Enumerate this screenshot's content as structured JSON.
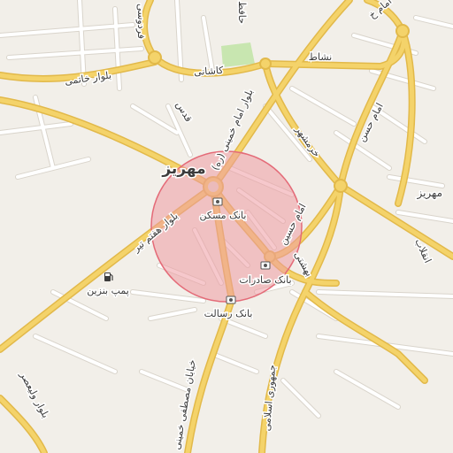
{
  "map": {
    "colors": {
      "land": "#f2efe9",
      "block": "#ffffff",
      "park": "#c8e6b0",
      "major_road": "#f4d36a",
      "major_road_casing": "#e2b94a",
      "minor_road": "#ffffff",
      "minor_road_casing": "#d9d4cb",
      "circle_fill": "#ef9aa2",
      "circle_stroke": "#e46b78",
      "label": "#3c3c3c",
      "label_halo": "#ffffff"
    },
    "highlight_circle": {
      "shape": "circle",
      "style": "translucent red radius overlay"
    },
    "labels": [
      {
        "name": "city-label",
        "text": "مهریز"
      },
      {
        "name": "town-label-east",
        "text": "مهریز"
      },
      {
        "name": "street-label-khatami",
        "text": "بلوار خاتمی"
      },
      {
        "name": "street-label-kashani",
        "text": "کاشانی"
      },
      {
        "name": "street-label-nashat",
        "text": "نشاط"
      },
      {
        "name": "street-label-imam-khomeini",
        "text": "بلوار امام خمینی (ره)"
      },
      {
        "name": "street-label-qods",
        "text": "قدس"
      },
      {
        "name": "street-label-khorramshahr",
        "text": "خرمشهر"
      },
      {
        "name": "street-label-imam-hasan",
        "text": "امام حسن"
      },
      {
        "name": "street-label-imam-hossein",
        "text": "امام حسین"
      },
      {
        "name": "street-label-imam-top",
        "text": "امام خ"
      },
      {
        "name": "street-label-beheshti",
        "text": "بهشتی"
      },
      {
        "name": "street-label-enghelab",
        "text": "انقلاب"
      },
      {
        "name": "street-label-haftom-tir",
        "text": "بلوار هفتم تیر"
      },
      {
        "name": "street-label-valiasr",
        "text": "بلوار ولیعصر"
      },
      {
        "name": "street-label-mostafa-khomeini",
        "text": "خیابان مصطفی خمینی"
      },
      {
        "name": "street-label-jomhouri",
        "text": "جمهوری اسلامی"
      },
      {
        "name": "street-label-ferdowsi",
        "text": "فردوسی"
      },
      {
        "name": "street-label-hafez",
        "text": "حافظ"
      },
      {
        "name": "poi-label-bank-maskan",
        "text": "بانک مسکن"
      },
      {
        "name": "poi-label-bank-saderat",
        "text": "بانک صادرات"
      },
      {
        "name": "poi-label-bank-resalat",
        "text": "بانک رسالت"
      },
      {
        "name": "poi-label-fuel",
        "text": "پمپ بنزین"
      }
    ],
    "icons": [
      {
        "name": "bank-icon",
        "label": "بانک مسکن"
      },
      {
        "name": "bank-icon",
        "label": "بانک صادرات"
      },
      {
        "name": "bank-icon",
        "label": "بانک رسالت"
      },
      {
        "name": "fuel-icon",
        "label": "پمپ بنزین"
      }
    ]
  }
}
